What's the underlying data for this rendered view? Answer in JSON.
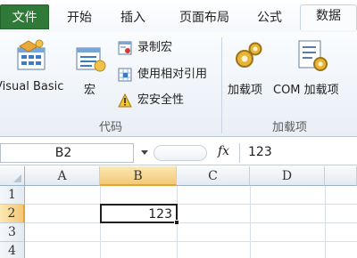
{
  "ribbon": {
    "tabs": [
      {
        "label": "文件"
      },
      {
        "label": "开始"
      },
      {
        "label": "插入"
      },
      {
        "label": "页面布局"
      },
      {
        "label": "公式"
      },
      {
        "label": "数据"
      }
    ],
    "code_group": {
      "label": "代码",
      "visual_basic": "Visual Basic",
      "macros": "宏",
      "record_macro": "录制宏",
      "relative_refs": "使用相对引用",
      "macro_security": "宏安全性"
    },
    "addins_group": {
      "label": "加载项",
      "addins": "加载项",
      "com_addins": "COM 加载项"
    }
  },
  "formula_bar": {
    "name_box": "B2",
    "fx_label": "fx",
    "formula": "123"
  },
  "sheet": {
    "columns": [
      "A",
      "B",
      "C",
      "D"
    ],
    "rows": [
      "1",
      "2",
      "3",
      "4"
    ],
    "active_cell_value": "123"
  },
  "colors": {
    "file_tab": "#2f7a38",
    "selected_header": "#f3c876",
    "ribbon_bg": "#e9eff6"
  }
}
